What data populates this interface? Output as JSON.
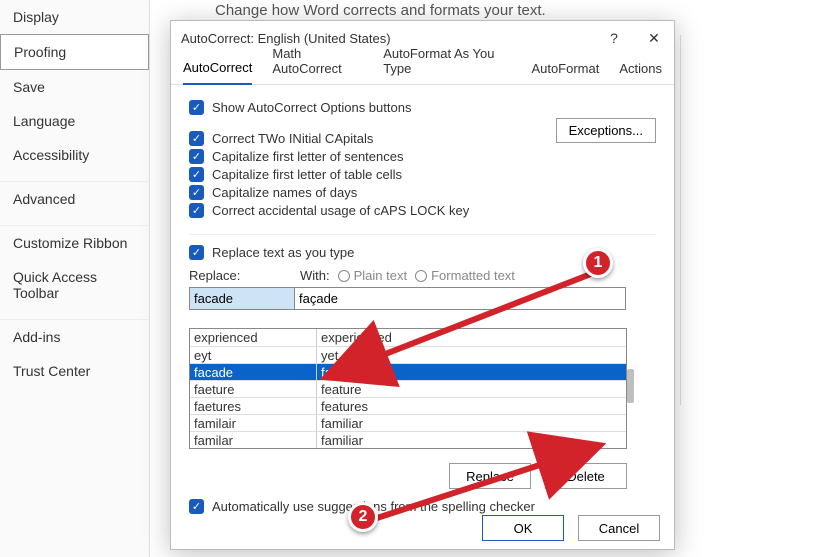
{
  "nav": {
    "items": [
      "Display",
      "Proofing",
      "Save",
      "Language",
      "Accessibility",
      "Advanced",
      "Customize Ribbon",
      "Quick Access Toolbar",
      "Add-ins",
      "Trust Center"
    ],
    "selected_index": 1
  },
  "background": {
    "header": "Change how Word corrects and formats your text."
  },
  "dialog": {
    "title": "AutoCorrect: English (United States)",
    "help": "?",
    "close": "✕",
    "tabs": [
      "AutoCorrect",
      "Math AutoCorrect",
      "AutoFormat As You Type",
      "AutoFormat",
      "Actions"
    ],
    "active_tab": 0,
    "show_options": "Show AutoCorrect Options buttons",
    "correct_two": "Correct TWo INitial CApitals",
    "cap_sentence": "Capitalize first letter of sentences",
    "cap_cells": "Capitalize first letter of table cells",
    "cap_days": "Capitalize names of days",
    "caps_lock": "Correct accidental usage of cAPS LOCK key",
    "exceptions": "Exceptions...",
    "replace_as_type": "Replace text as you type",
    "replace_label": "Replace:",
    "with_label": "With:",
    "plain_text": "Plain text",
    "formatted_text": "Formatted text",
    "replace_value": "facade",
    "with_value": "façade",
    "list": [
      {
        "from": "exprienced",
        "to": "experienced"
      },
      {
        "from": "eyt",
        "to": "yet"
      },
      {
        "from": "facade",
        "to": "façade"
      },
      {
        "from": "faeture",
        "to": "feature"
      },
      {
        "from": "faetures",
        "to": "features"
      },
      {
        "from": "familair",
        "to": "familiar"
      },
      {
        "from": "familar",
        "to": "familiar"
      }
    ],
    "selected_row": 2,
    "replace_btn": "Replace",
    "delete_btn": "Delete",
    "auto_suggest": "Automatically use suggestions from the spelling checker",
    "ok": "OK",
    "cancel": "Cancel"
  },
  "markers": {
    "m1": "1",
    "m2": "2"
  }
}
